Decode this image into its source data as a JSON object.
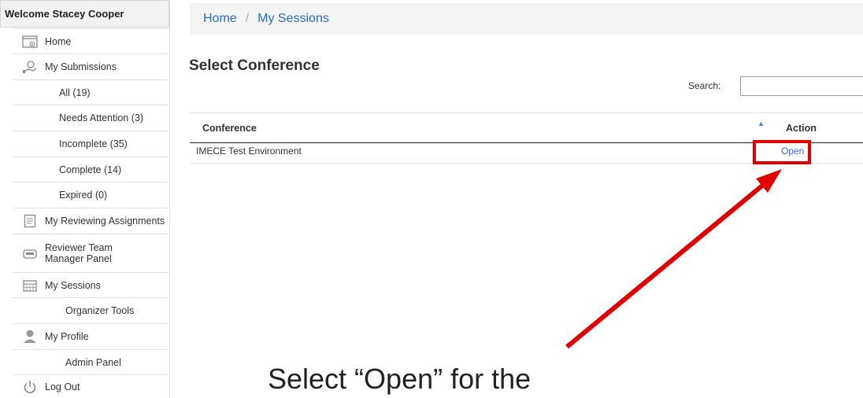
{
  "sidebar": {
    "welcome": "Welcome Stacey Cooper",
    "items": [
      {
        "label": "Home",
        "icon": "home-icon"
      },
      {
        "label": "My Submissions",
        "icon": "submissions-icon"
      },
      {
        "label": "All (19)"
      },
      {
        "label": "Needs Attention (3)"
      },
      {
        "label": "Incomplete (35)"
      },
      {
        "label": "Complete (14)"
      },
      {
        "label": "Expired (0)"
      },
      {
        "label": "My Reviewing Assignments",
        "icon": "clipboard-icon"
      },
      {
        "label": "Reviewer Team Manager Panel",
        "icon": "team-icon"
      },
      {
        "label": "My Sessions",
        "icon": "calendar-icon"
      },
      {
        "label": "Organizer Tools"
      },
      {
        "label": "My Profile",
        "icon": "user-icon"
      },
      {
        "label": "Admin Panel"
      },
      {
        "label": "Log Out",
        "icon": "power-icon"
      }
    ]
  },
  "breadcrumb": {
    "home": "Home",
    "separator": "/",
    "current": "My Sessions"
  },
  "page": {
    "title": "Select Conference"
  },
  "search": {
    "label": "Search:",
    "value": "",
    "placeholder": ""
  },
  "table": {
    "headers": {
      "conference": "Conference",
      "action": "Action"
    },
    "rows": [
      {
        "conference": "IMECE Test Environment",
        "action": "Open"
      }
    ]
  },
  "annotation": {
    "caption": "Select “Open” for the",
    "color": "#e00000"
  }
}
